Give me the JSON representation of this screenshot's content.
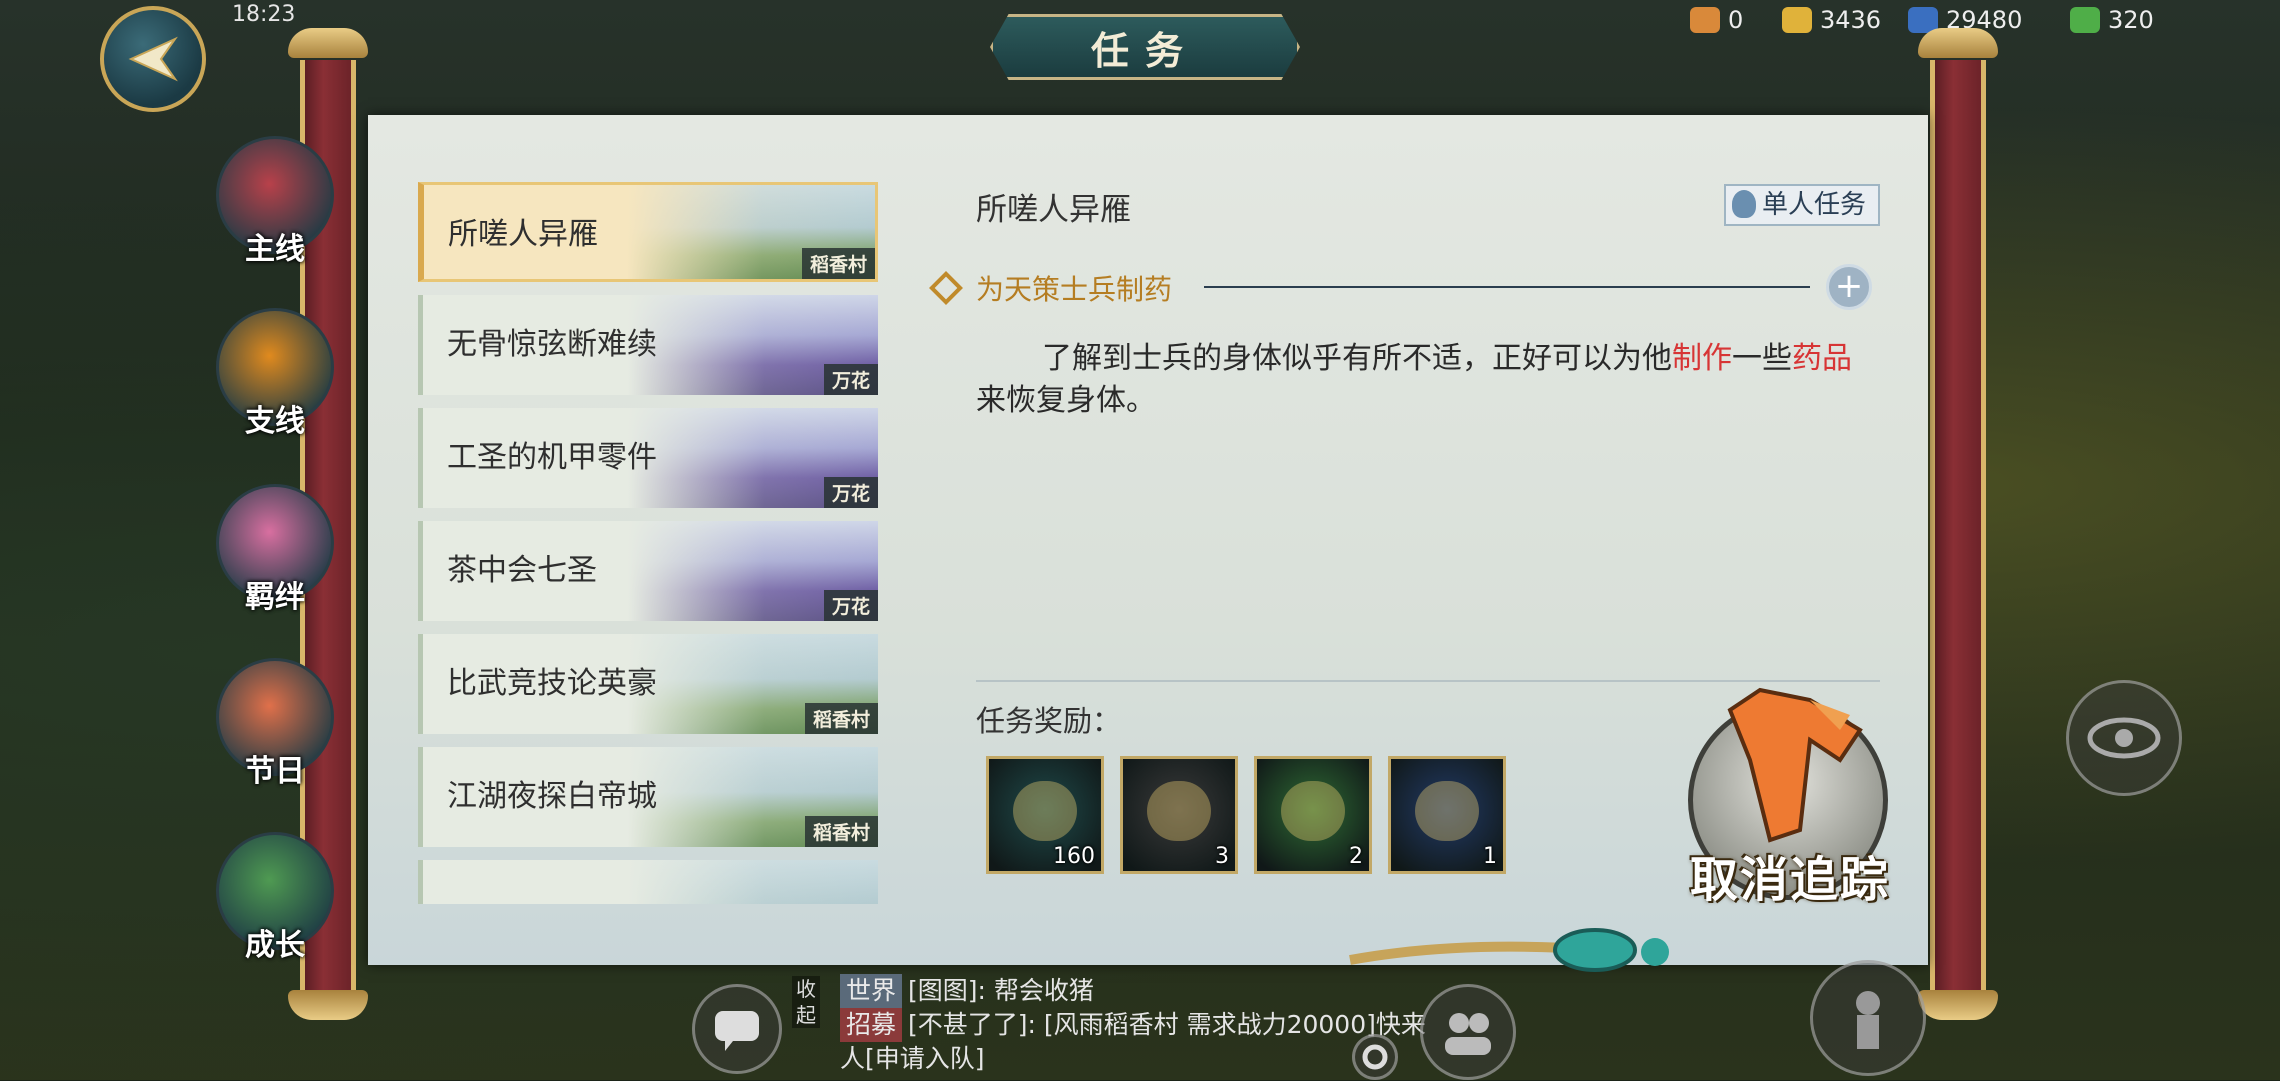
{
  "status_bar": {
    "time": "18:23"
  },
  "top_resources": [
    {
      "icon": "lucky-bag-icon",
      "value": "0",
      "color": "#d9893a"
    },
    {
      "icon": "gold-ingot-icon",
      "value": "3436",
      "color": "#e0b23a"
    },
    {
      "icon": "silver-coin-icon",
      "value": "29480",
      "color": "#3a6fc0"
    },
    {
      "icon": "clover-icon",
      "value": "320",
      "color": "#4fae48"
    }
  ],
  "window": {
    "title": "任务"
  },
  "side_tabs": [
    {
      "label": "主线",
      "icon": "dragon-icon",
      "color": "#b8414a"
    },
    {
      "label": "支线",
      "icon": "tiger-icon",
      "color": "#e08a1e"
    },
    {
      "label": "羁绊",
      "icon": "lotus-bird-icon",
      "color": "#d86fa0"
    },
    {
      "label": "节日",
      "icon": "koi-fish-icon",
      "color": "#e0704a"
    },
    {
      "label": "成长",
      "icon": "bamboo-icon",
      "color": "#4f9a52"
    }
  ],
  "quests": [
    {
      "name": "所嗟人异雁",
      "location": "稻香村",
      "scene": "village",
      "active": true
    },
    {
      "name": "无骨惊弦断难续",
      "location": "万花",
      "scene": "wanhua",
      "active": false
    },
    {
      "name": "工圣的机甲零件",
      "location": "万花",
      "scene": "wanhua",
      "active": false
    },
    {
      "name": "茶中会七圣",
      "location": "万花",
      "scene": "wanhua",
      "active": false
    },
    {
      "name": "比武竞技论英豪",
      "location": "稻香村",
      "scene": "village",
      "active": false
    },
    {
      "name": "江湖夜探白帝城",
      "location": "稻香村",
      "scene": "village",
      "active": false
    },
    {
      "name": "",
      "location": "",
      "scene": "village",
      "active": false
    }
  ],
  "detail": {
    "title": "所嗟人异雁",
    "type_badge": "单人任务",
    "subtask": "为天策士兵制药",
    "description": {
      "part1": "了解到士兵的身体似乎有所不适，正好可以为他",
      "hl1": "制作",
      "part2": "一些",
      "hl2": "药品",
      "part3": "来恢复身体。"
    },
    "reward_label": "任务奖励：",
    "rewards": [
      {
        "icon": "gold-ingots-icon",
        "count": "160",
        "bg": "#1f4a4a"
      },
      {
        "icon": "red-berries-icon",
        "count": "3",
        "bg": "#3a3a3a"
      },
      {
        "icon": "bok-choy-icon",
        "count": "2",
        "bg": "#2f6b34"
      },
      {
        "icon": "incense-burner-icon",
        "count": "1",
        "bg": "#223a66"
      }
    ],
    "cancel_track_label": "取消追踪"
  },
  "chat": {
    "toggle": "收起",
    "lines": [
      {
        "channel": "世界",
        "text": "[图图]: 帮会收猪"
      },
      {
        "channel": "招募",
        "text": "[不甚了了]: [风雨稻香村 需求战力20000]快来人[申请入队]"
      }
    ]
  }
}
